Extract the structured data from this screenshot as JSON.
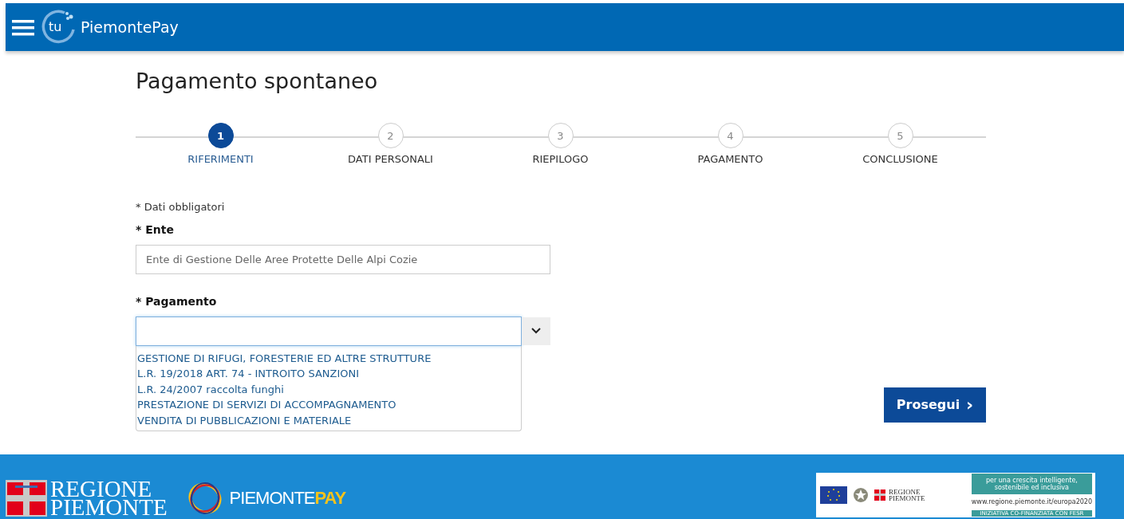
{
  "header": {
    "logo_mark": "tu",
    "brand": "PiemontePay"
  },
  "page_title": "Pagamento spontaneo",
  "steps": [
    {
      "number": "1",
      "label": "RIFERIMENTI",
      "selected": true
    },
    {
      "number": "2",
      "label": "DATI PERSONALI",
      "selected": false
    },
    {
      "number": "3",
      "label": "RIEPILOGO",
      "selected": false
    },
    {
      "number": "4",
      "label": "PAGAMENTO",
      "selected": false
    },
    {
      "number": "5",
      "label": "CONCLUSIONE",
      "selected": false
    }
  ],
  "required_note": "* Dati obbligatori",
  "ente": {
    "label": "* Ente",
    "value": "Ente di Gestione Delle Aree Protette Delle Alpi Cozie",
    "disabled": true
  },
  "pagamento": {
    "label": "* Pagamento",
    "expanded": true,
    "options": [
      {
        "text": "GESTIONE DI RIFUGI, FORESTERIE ED ALTRE STRUTTURE"
      },
      {
        "text": "L.R. 19/2018 ART. 74 - INTROITO SANZIONI"
      },
      {
        "text": "L.R. 24/2007 raccolta funghi"
      },
      {
        "text": "PRESTAZIONE DI SERVIZI DI ACCOMPAGNAMENTO"
      },
      {
        "text": "VENDITA DI PUBBLICAZIONI E MATERIALE"
      }
    ]
  },
  "next_button": {
    "label": "Prosegui",
    "arrow": "›"
  },
  "footer": {
    "regione_lines": [
      "REGIONE",
      "PIEMONTE"
    ],
    "piemontepay": [
      "PIEMONTE",
      "PAY"
    ],
    "eu_banner": {
      "regione_lines": [
        "REGIONE",
        "PIEMONTE"
      ],
      "slogan_lines": [
        "per una crescita intelligente,",
        "sostenibile ed inclusiva"
      ],
      "url": "www.regione.piemonte.it/europa2020",
      "cofinance": "INIZIATIVA CO-FINANZIATA CON FESR"
    }
  }
}
